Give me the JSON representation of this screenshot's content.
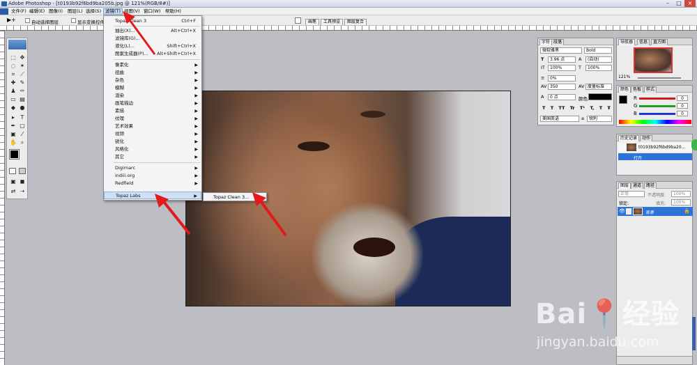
{
  "window": {
    "title": "Adobe Photoshop - [t0193b92f6bd9ba205b.jpg @ 121%(RGB/8#)]",
    "min": "–",
    "max": "□",
    "close": "×"
  },
  "menubar": {
    "items": [
      "文件(F)",
      "编辑(E)",
      "图像(I)",
      "图层(L)",
      "选择(S)",
      "滤镜(T)",
      "视图(V)",
      "窗口(W)",
      "帮助(H)"
    ]
  },
  "options": {
    "auto_select": "自动选择图层",
    "show_bounds": "显示变换控件",
    "tool_arrow": "▶+"
  },
  "wells": [
    "画笔",
    "工具预设",
    "图层复合"
  ],
  "filter_menu": {
    "items": [
      {
        "label": "Topaz Clean 3",
        "shortcut": "Ctrl+F"
      },
      {
        "label": "抽出(X)...",
        "shortcut": "Alt+Ctrl+X"
      },
      {
        "label": "滤镜库(G)...",
        "shortcut": ""
      },
      {
        "label": "液化(L)...",
        "shortcut": "Shift+Ctrl+X"
      },
      {
        "label": "图案生成器(P)...",
        "shortcut": "Alt+Shift+Ctrl+X"
      },
      {
        "label": "像素化",
        "sub": true
      },
      {
        "label": "扭曲",
        "sub": true
      },
      {
        "label": "杂色",
        "sub": true
      },
      {
        "label": "模糊",
        "sub": true
      },
      {
        "label": "渲染",
        "sub": true
      },
      {
        "label": "画笔描边",
        "sub": true
      },
      {
        "label": "素描",
        "sub": true
      },
      {
        "label": "纹理",
        "sub": true
      },
      {
        "label": "艺术效果",
        "sub": true
      },
      {
        "label": "视频",
        "sub": true
      },
      {
        "label": "锐化",
        "sub": true
      },
      {
        "label": "风格化",
        "sub": true
      },
      {
        "label": "其它",
        "sub": true
      },
      {
        "label": "Digimarc",
        "sub": true
      },
      {
        "label": "indiii.org",
        "sub": true
      },
      {
        "label": "Redfield",
        "sub": true
      },
      {
        "label": "Topaz Labs",
        "sub": true
      }
    ],
    "submenu_item": "Topaz Clean 3..."
  },
  "char_panel": {
    "tabs": [
      "字符",
      "段落"
    ],
    "font": "微软雅黑",
    "style": "Bold",
    "size": "3.96 点",
    "leading": "(自动)",
    "vscale": "100%",
    "hscale": "100%",
    "tracking": "0%",
    "kerning": "350",
    "kerning_opt": "度量标准",
    "baseline": "0 点",
    "color_label": "颜色:",
    "styles": [
      "T",
      "T",
      "TT",
      "Tr",
      "T¹",
      "T,",
      "T",
      "Ŧ"
    ],
    "lang": "美国英语",
    "aa": "锐利"
  },
  "nav_panel": {
    "tabs": [
      "导航器",
      "信息",
      "直方图"
    ],
    "zoom": "121%"
  },
  "color_panel": {
    "tabs": [
      "颜色",
      "色板",
      "样式"
    ],
    "channels": [
      {
        "ch": "R",
        "val": "0",
        "color": "#d21c1c"
      },
      {
        "ch": "G",
        "val": "0",
        "color": "#1ca01c"
      },
      {
        "ch": "B",
        "val": "0",
        "color": "#1c3ad2"
      }
    ]
  },
  "history_panel": {
    "tabs": [
      "历史记录",
      "动作"
    ],
    "snapshot": "t0193b92f6bd9ba20...",
    "state": "打开"
  },
  "layers_panel": {
    "tabs": [
      "图层",
      "通道",
      "路径"
    ],
    "mode": "正常",
    "opacity_label": "不透明度:",
    "opacity": "100%",
    "lock_label": "锁定:",
    "fill_label": "填充:",
    "fill": "100%",
    "layer": "背景"
  },
  "watermark": {
    "logo": "Bai📍经验",
    "url": "jingyan.baidu.com"
  }
}
